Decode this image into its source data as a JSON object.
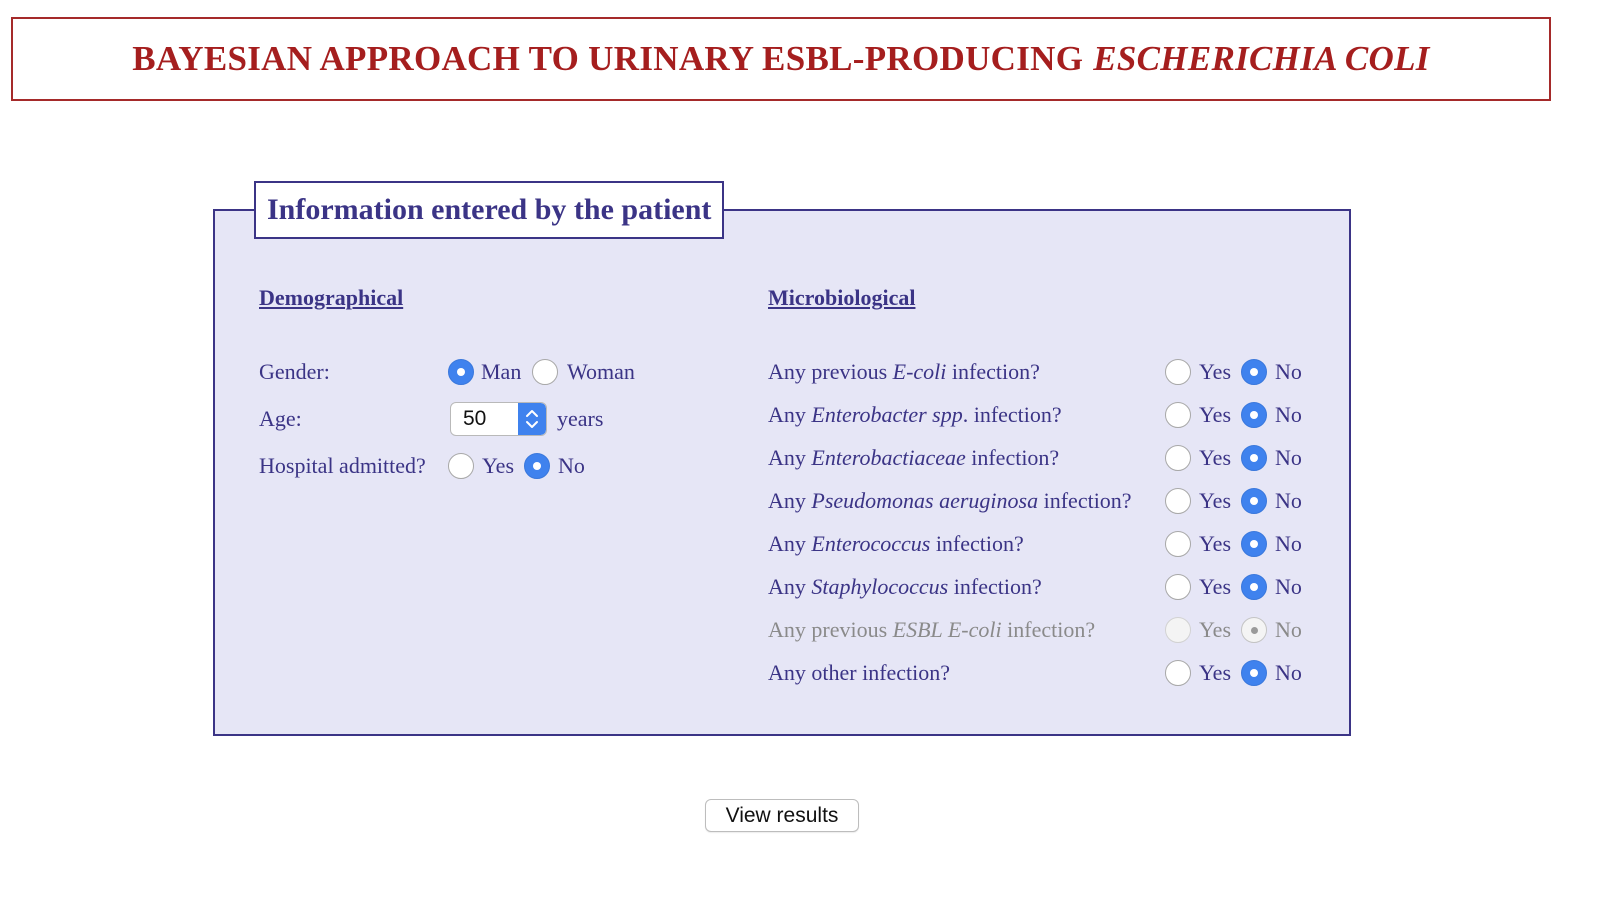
{
  "header": {
    "title": "BAYESIAN APPROACH TO URINARY ESBL-PRODUCING",
    "title_italic": "ESCHERICHIA COLI",
    "color": "#a51e1e"
  },
  "panel": {
    "legend": "Information entered by the patient",
    "background": "#e6e6f6",
    "accent": "#3b3486"
  },
  "demographical": {
    "heading": "Demographical",
    "gender": {
      "label": "Gender:",
      "options": [
        "Man",
        "Woman"
      ],
      "selected": "Man"
    },
    "age": {
      "label": "Age:",
      "value": "50",
      "unit": "years"
    },
    "hospital": {
      "label": "Hospital admitted?",
      "options": [
        "Yes",
        "No"
      ],
      "selected": "No"
    }
  },
  "microbiological": {
    "heading": "Microbiological",
    "yes_label": "Yes",
    "no_label": "No",
    "questions": [
      {
        "pre": "Any previous ",
        "ital": "E-coli",
        "post": " infection?",
        "selected": "No",
        "disabled": false
      },
      {
        "pre": "Any ",
        "ital": "Enterobacter spp",
        "post": ". infection?",
        "selected": "No",
        "disabled": false
      },
      {
        "pre": "Any ",
        "ital": "Enterobactiaceae",
        "post": " infection?",
        "selected": "No",
        "disabled": false
      },
      {
        "pre": "Any ",
        "ital": "Pseudomonas aeruginosa",
        "post": " infection?",
        "selected": "No",
        "disabled": false
      },
      {
        "pre": "Any ",
        "ital": "Enterococcus",
        "post": " infection?",
        "selected": "No",
        "disabled": false
      },
      {
        "pre": "Any ",
        "ital": "Staphylococcus",
        "post": " infection?",
        "selected": "No",
        "disabled": false
      },
      {
        "pre": "Any previous ",
        "ital": "ESBL E-coli",
        "post": " infection?",
        "selected": "No",
        "disabled": true
      },
      {
        "pre": "Any other infection?",
        "ital": "",
        "post": "",
        "selected": "No",
        "disabled": false
      }
    ]
  },
  "actions": {
    "view_results": "View results"
  }
}
